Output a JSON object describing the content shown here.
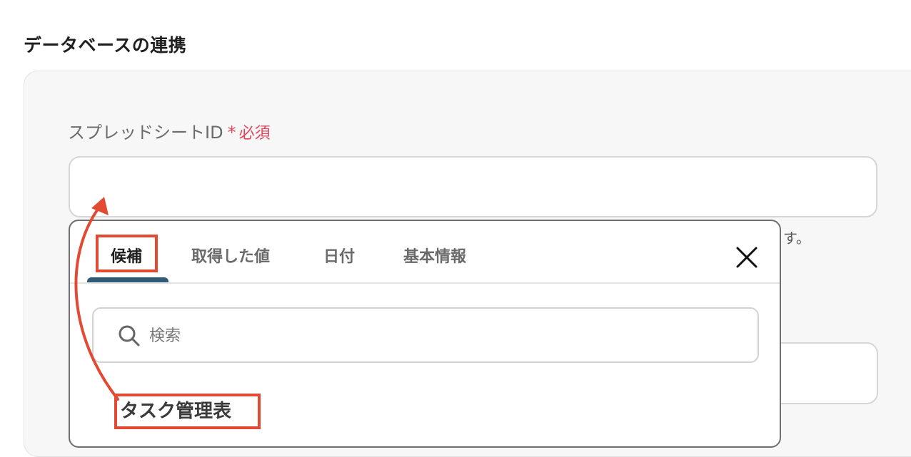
{
  "section": {
    "title": "データベースの連携"
  },
  "field": {
    "label": "スプレッドシートID",
    "required_star": "*",
    "required_text": "必須",
    "value": "",
    "hint_suffix": "す。"
  },
  "popup": {
    "tabs": [
      {
        "label": "候補",
        "active": true
      },
      {
        "label": "取得した値",
        "active": false
      },
      {
        "label": "日付",
        "active": false
      },
      {
        "label": "基本情報",
        "active": false
      }
    ],
    "close_icon": "close-icon",
    "search": {
      "placeholder": "検索",
      "value": "",
      "icon": "search-icon"
    },
    "candidates": [
      "タスク管理表"
    ]
  },
  "colors": {
    "accent_tab": "#2f5b78",
    "required": "#e0475b",
    "annotation": "#e24a33"
  }
}
